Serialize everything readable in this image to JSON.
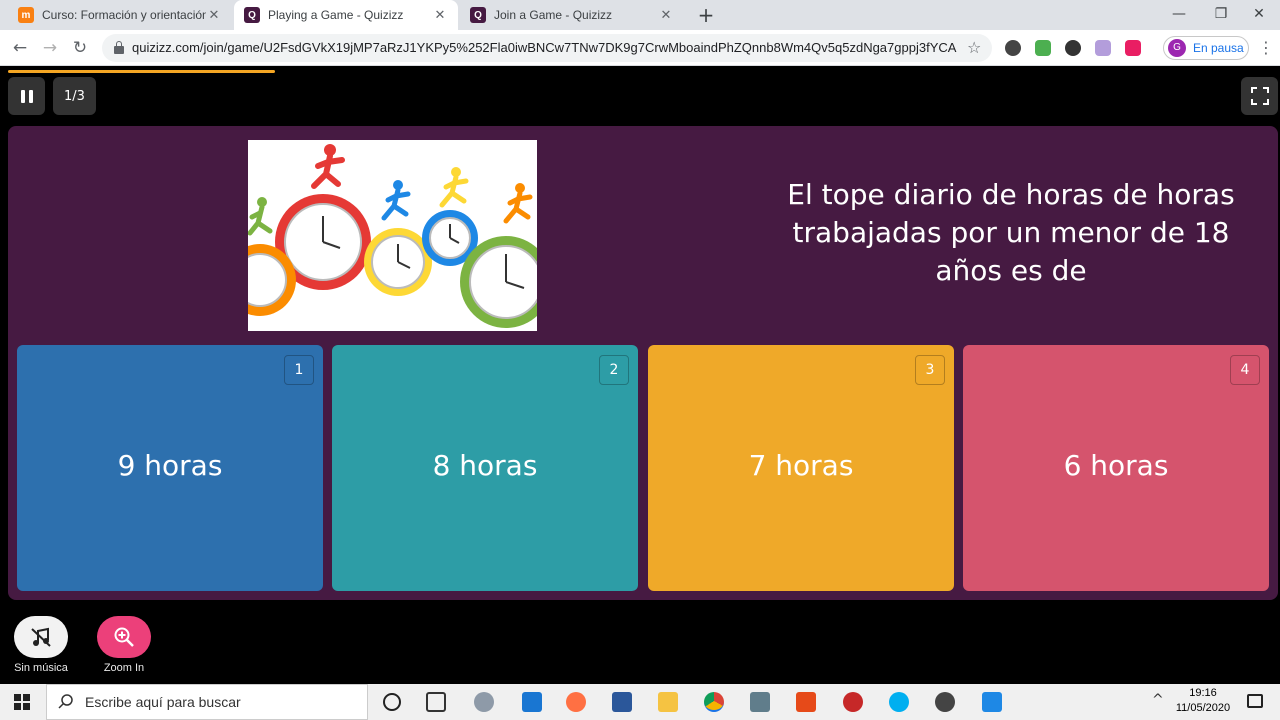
{
  "browser": {
    "tabs": [
      {
        "title": "Curso: Formación y orientación la",
        "active": false,
        "icon": "moodle-favicon-icon"
      },
      {
        "title": "Playing a Game - Quizizz",
        "active": true,
        "icon": "quizizz-favicon-icon"
      },
      {
        "title": "Join a Game - Quizizz",
        "active": false,
        "icon": "quizizz-favicon-icon"
      }
    ],
    "url": "quizizz.com/join/game/U2FsdGVkX19jMP7aRzJ1YKPy5%252Fla0iwBNCw7TNw7DK9g7CrwMboaindPhZQnnb8Wm4Qv5q5zdNga7gppj3fYCA...",
    "profile_initial": "G",
    "profile_status": "En pausa"
  },
  "game": {
    "question_counter": "1/3",
    "progress_fraction": 0.21,
    "question_text": "El tope diario de horas de horas trabajadas por un menor de 18 años es de",
    "options": [
      {
        "number": "1",
        "label": "9 horas",
        "color": "#2d70ae"
      },
      {
        "number": "2",
        "label": "8 horas",
        "color": "#2d9da6"
      },
      {
        "number": "3",
        "label": "7 horas",
        "color": "#efa929"
      },
      {
        "number": "4",
        "label": "6 horas",
        "color": "#d5546d"
      }
    ],
    "music_label": "Sin música",
    "zoom_label": "Zoom In",
    "accent_color": "#461a42"
  },
  "taskbar": {
    "search_placeholder": "Escribe aquí para buscar",
    "time": "19:16",
    "date": "11/05/2020"
  }
}
